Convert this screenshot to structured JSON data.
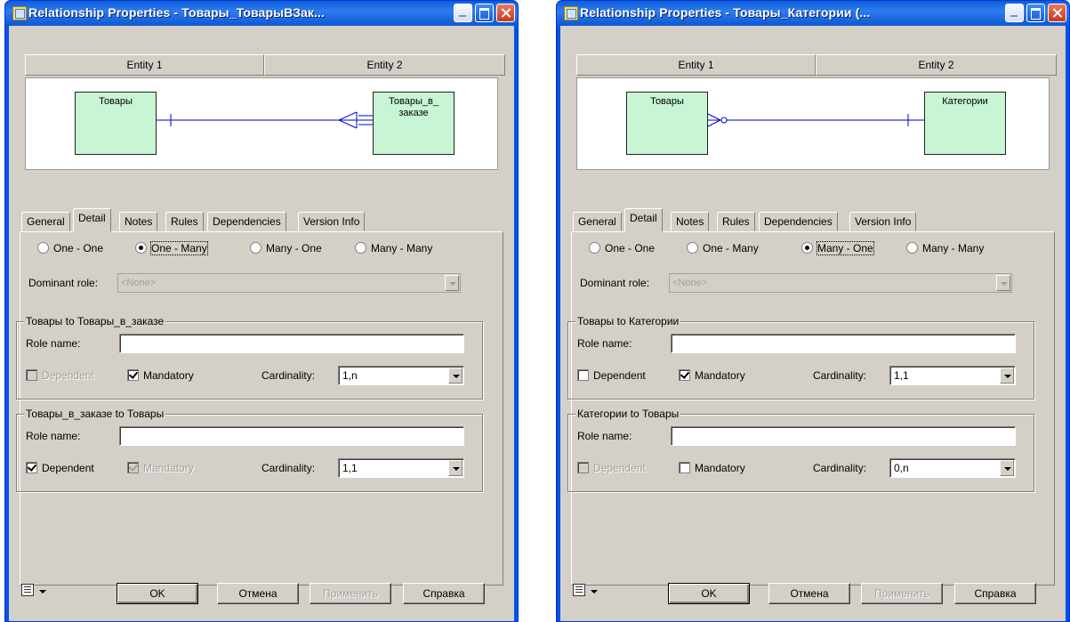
{
  "windows": [
    {
      "title": "Relationship Properties - Товары_ТоварыВЗак...",
      "entity_headers": [
        "Entity 1",
        "Entity 2"
      ],
      "entity1_name": "Товары",
      "entity2_name": "Товары_в_ заказе",
      "tabs": [
        "General",
        "Detail",
        "Notes",
        "Rules",
        "Dependencies",
        "Version Info"
      ],
      "active_tab": "Detail",
      "radios": [
        "One - One",
        "One - Many",
        "Many - One",
        "Many - Many"
      ],
      "selected_radio": "One - Many",
      "dominant_role_label": "Dominant role:",
      "dominant_role_value": "<None>",
      "group1": {
        "title": "Товары to Товары_в_заказе",
        "role_name_label": "Role name:",
        "role_name_value": "",
        "dependent_label": "Dependent",
        "dependent_checked": false,
        "dependent_enabled": false,
        "mandatory_label": "Mandatory",
        "mandatory_checked": true,
        "mandatory_enabled": true,
        "cardinality_label": "Cardinality:",
        "cardinality_value": "1,n"
      },
      "group2": {
        "title": "Товары_в_заказе to Товары",
        "role_name_label": "Role name:",
        "role_name_value": "",
        "dependent_label": "Dependent",
        "dependent_checked": true,
        "dependent_enabled": true,
        "mandatory_label": "Mandatory",
        "mandatory_checked": true,
        "mandatory_enabled": false,
        "cardinality_label": "Cardinality:",
        "cardinality_value": "1,1"
      },
      "buttons": {
        "ok": "OK",
        "cancel": "Отмена",
        "apply": "Применить",
        "help": "Справка"
      }
    },
    {
      "title": "Relationship Properties - Товары_Категории (...",
      "entity_headers": [
        "Entity 1",
        "Entity 2"
      ],
      "entity1_name": "Товары",
      "entity2_name": "Категории",
      "tabs": [
        "General",
        "Detail",
        "Notes",
        "Rules",
        "Dependencies",
        "Version Info"
      ],
      "active_tab": "Detail",
      "radios": [
        "One - One",
        "One - Many",
        "Many - One",
        "Many - Many"
      ],
      "selected_radio": "Many - One",
      "dominant_role_label": "Dominant role:",
      "dominant_role_value": "<None>",
      "group1": {
        "title": "Товары to Категории",
        "role_name_label": "Role name:",
        "role_name_value": "",
        "dependent_label": "Dependent",
        "dependent_checked": false,
        "dependent_enabled": true,
        "mandatory_label": "Mandatory",
        "mandatory_checked": true,
        "mandatory_enabled": true,
        "cardinality_label": "Cardinality:",
        "cardinality_value": "1,1"
      },
      "group2": {
        "title": "Категории to Товары",
        "role_name_label": "Role name:",
        "role_name_value": "",
        "dependent_label": "Dependent",
        "dependent_checked": false,
        "dependent_enabled": false,
        "mandatory_label": "Mandatory",
        "mandatory_checked": false,
        "mandatory_enabled": true,
        "cardinality_label": "Cardinality:",
        "cardinality_value": "0,n"
      },
      "buttons": {
        "ok": "OK",
        "cancel": "Отмена",
        "apply": "Применить",
        "help": "Справка"
      }
    }
  ]
}
